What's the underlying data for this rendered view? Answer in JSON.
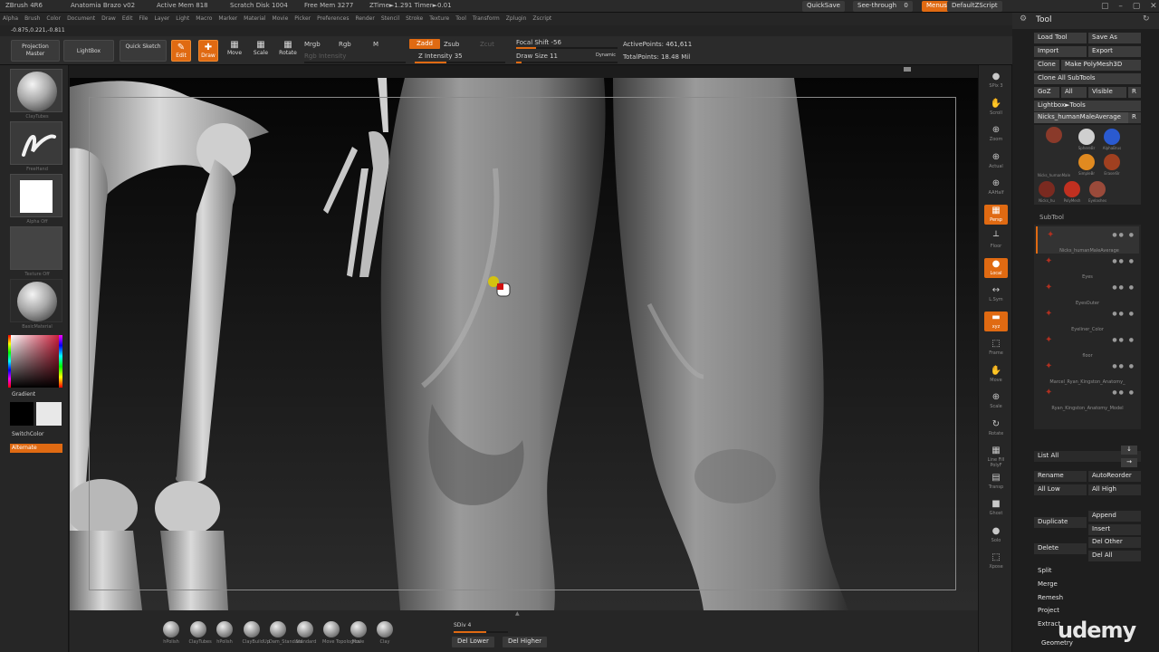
{
  "app": {
    "title": "ZBrush 4R6",
    "document": "Anatomia Brazo v02",
    "status": {
      "active_mem": "Active Mem 818",
      "scratch_disk": "Scratch Disk 1004",
      "free_mem": "Free Mem 3277",
      "timer": "ZTime►1.291 Timer►0.01"
    },
    "coords": "-0.875,0.221,-0.811"
  },
  "top_right": {
    "quicksave": "QuickSave",
    "see_through": "See-through",
    "see_through_value": "0",
    "menus": "Menus",
    "default_zscript": "DefaultZScript"
  },
  "menu_items": [
    "Alpha",
    "Brush",
    "Color",
    "Document",
    "Draw",
    "Edit",
    "File",
    "Layer",
    "Light",
    "Macro",
    "Marker",
    "Material",
    "Movie",
    "Picker",
    "Preferences",
    "Render",
    "Stencil",
    "Stroke",
    "Texture",
    "Tool",
    "Transform",
    "Zplugin",
    "Zscript"
  ],
  "toolbar": {
    "projection_master": "Projection Master",
    "lightbox": "LightBox",
    "quick_sketch": "Quick Sketch",
    "edit": "Edit",
    "draw": "Draw",
    "move": "Move",
    "scale": "Scale",
    "rotate": "Rotate",
    "mrgb": "Mrgb",
    "rgb": "Rgb",
    "m": "M",
    "rgb_intensity": "Rgb Intensity",
    "zadd": "Zadd",
    "zsub": "Zsub",
    "zcut": "Zcut",
    "z_intensity": "Z Intensity 35",
    "focal_shift": "Focal Shift -56",
    "draw_size": "Draw Size 11",
    "dynamic": "Dynamic",
    "active_points": "ActivePoints: 461,611",
    "total_points": "TotalPoints: 18.48 Mil"
  },
  "left_shelf": {
    "brush_caption": "ClayTubes",
    "stroke_caption": "FreeHand",
    "alpha_caption": "Alpha Off",
    "texture_caption": "Texture Off",
    "material_caption": "BasicMaterial",
    "gradient": "Gradient",
    "switch_color": "SwitchColor",
    "alternate": "Alternate"
  },
  "right_shelf": [
    {
      "label": "SPix 3",
      "icon": "●"
    },
    {
      "label": "Scroll",
      "icon": "✋"
    },
    {
      "label": "Zoom",
      "icon": "⊕"
    },
    {
      "label": "Actual",
      "icon": "⊕"
    },
    {
      "label": "AAHalf",
      "icon": "⊕"
    },
    {
      "label": "Persp",
      "icon": "▦"
    },
    {
      "label": "Floor",
      "icon": "┴"
    },
    {
      "label": "Local",
      "icon": "●"
    },
    {
      "label": "L.Sym",
      "icon": "↔"
    },
    {
      "label": "xyz",
      "icon": "▬"
    },
    {
      "label": "Frame",
      "icon": "⬚"
    },
    {
      "label": "Move",
      "icon": "✋"
    },
    {
      "label": "Scale",
      "icon": "⊕"
    },
    {
      "label": "Rotate",
      "icon": "↻"
    },
    {
      "label": "Line Fill PolyF",
      "icon": "▦"
    },
    {
      "label": "Transp",
      "icon": "▤"
    },
    {
      "label": "Ghost",
      "icon": "■"
    },
    {
      "label": "Solo",
      "icon": "●"
    },
    {
      "label": "Xpose",
      "icon": "⬚"
    }
  ],
  "bottom": {
    "brushes": [
      "hPolish",
      "ClayTubes",
      "hPolish",
      "ClayBuildUp",
      "Dam_Standard",
      "Standard",
      "Move Topological",
      "Move",
      "Clay"
    ],
    "sdiv": "SDiv 4",
    "del_lower": "Del Lower",
    "del_higher": "Del Higher"
  },
  "tool_panel": {
    "title": "Tool",
    "load_tool": "Load Tool",
    "save_as": "Save As",
    "import": "Import",
    "export": "Export",
    "clone": "Clone",
    "make_polymesh": "Make PolyMesh3D",
    "clone_all": "Clone All SubTools",
    "goz": "GoZ",
    "all": "All",
    "visible": "Visible",
    "r": "R",
    "lightbox_tools": "Lightbox►Tools",
    "current_tool": "Nicks_humanMaleAverage",
    "current_tool_r": "R",
    "tool_thumbs": [
      "Nicks_humanMale",
      "SphereBr",
      "AlphaBrus",
      "SimpleBr",
      "EraserBr",
      "Nicks_hu",
      "PolyMesh",
      "Eyelashes"
    ],
    "subtool": "SubTool",
    "subtools": [
      "Nicks_humanMaleAverage",
      "Eyes",
      "EyesOuter",
      "Eyeliner_Color",
      "floor",
      "Marcel_Ryan_Kingston_Anatomy_",
      "Ryan_Kingston_Anatomy_Model"
    ],
    "list_all": "List All",
    "rename": "Rename",
    "auto_reorder": "AutoReorder",
    "all_low": "All Low",
    "all_high": "All High",
    "append": "Append",
    "duplicate": "Duplicate",
    "insert": "Insert",
    "delete": "Delete",
    "del_other": "Del Other",
    "del_all": "Del All",
    "split": "Split",
    "merge": "Merge",
    "remesh": "Remesh",
    "project": "Project",
    "extract": "Extract",
    "geometry": "Geometry"
  },
  "watermark": "udemy",
  "colors": {
    "accent": "#e06a12",
    "background": "#1c1c1c",
    "panel": "#2b2b2b"
  }
}
